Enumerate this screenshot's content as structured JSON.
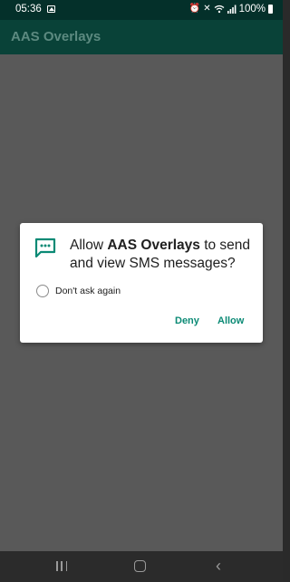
{
  "status_bar": {
    "time": "05:36",
    "battery": "100%",
    "icons": [
      "image-icon",
      "alarm-icon",
      "mute-icon",
      "wifi-icon",
      "signal-icon",
      "battery-icon"
    ]
  },
  "app_bar": {
    "title": "AAS Overlays"
  },
  "dialog": {
    "icon": "sms-icon",
    "message_prefix": "Allow ",
    "app_name": "AAS Overlays",
    "message_suffix": " to send and view SMS messages?",
    "checkbox_label": "Don't ask again",
    "checkbox_checked": false,
    "deny_label": "Deny",
    "allow_label": "Allow",
    "accent_color": "#0b8a75"
  },
  "nav_bar": {
    "buttons": [
      "recents-icon",
      "home-icon",
      "back-icon"
    ]
  }
}
